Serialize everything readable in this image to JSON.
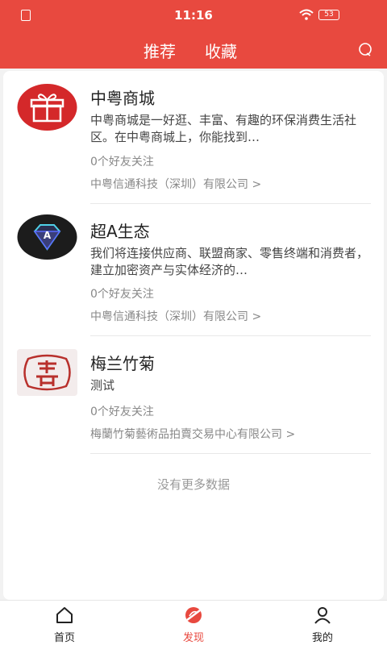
{
  "status_bar": {
    "time": "11:16",
    "battery": "53"
  },
  "header": {
    "tabs": [
      {
        "label": "推荐"
      },
      {
        "label": "收藏"
      }
    ]
  },
  "items": [
    {
      "name": "中粤商城",
      "desc": "中粤商城是一好逛、丰富、有趣的环保消费生活社区。在中粤商城上，你能找到…",
      "followers": "0个好友关注",
      "company": "中粤信通科技（深圳）有限公司 >",
      "logo_icon": "gift-icon"
    },
    {
      "name": "超A生态",
      "desc": "我们将连接供应商、联盟商家、零售终端和消费者，建立加密资产与实体经济的…",
      "followers": "0个好友关注",
      "company": "中粤信通科技（深圳）有限公司 >",
      "logo_icon": "diamond-a-icon"
    },
    {
      "name": "梅兰竹菊",
      "desc": "测试",
      "followers": "0个好友关注",
      "company": "梅蘭竹菊藝術品拍賣交易中心有限公司 >",
      "logo_icon": "seal-logo"
    }
  ],
  "footer_text": "没有更多数据",
  "tabbar": {
    "tabs": [
      {
        "label": "首页",
        "icon": "home-icon"
      },
      {
        "label": "发现",
        "icon": "discover-icon",
        "active": true
      },
      {
        "label": "我的",
        "icon": "user-icon"
      }
    ]
  },
  "colors": {
    "brand": "#e8493f"
  }
}
